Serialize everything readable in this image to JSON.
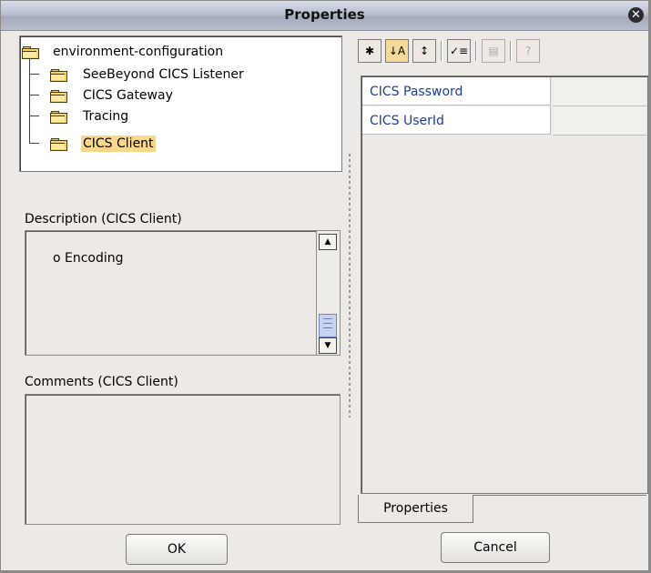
{
  "window": {
    "title": "Properties"
  },
  "tree": {
    "root": "environment-configuration",
    "children": [
      "SeeBeyond CICS Listener",
      "CICS Gateway",
      "Tracing",
      "CICS Client"
    ],
    "selected": "CICS Client"
  },
  "description": {
    "label": "Description (CICS Client)",
    "text": "o Encoding"
  },
  "comments": {
    "label": "Comments (CICS Client)",
    "text": ""
  },
  "toolbar": {
    "icons": [
      "expand-icon",
      "sort-alphabetical-icon",
      "sort-category-icon",
      "show-editable-icon",
      "properties-view-icon",
      "help-icon"
    ]
  },
  "properties": {
    "rows": [
      {
        "name": "CICS Password",
        "value": ""
      },
      {
        "name": "CICS UserId",
        "value": ""
      }
    ],
    "tab": "Properties"
  },
  "buttons": {
    "ok": "OK",
    "cancel": "Cancel"
  }
}
